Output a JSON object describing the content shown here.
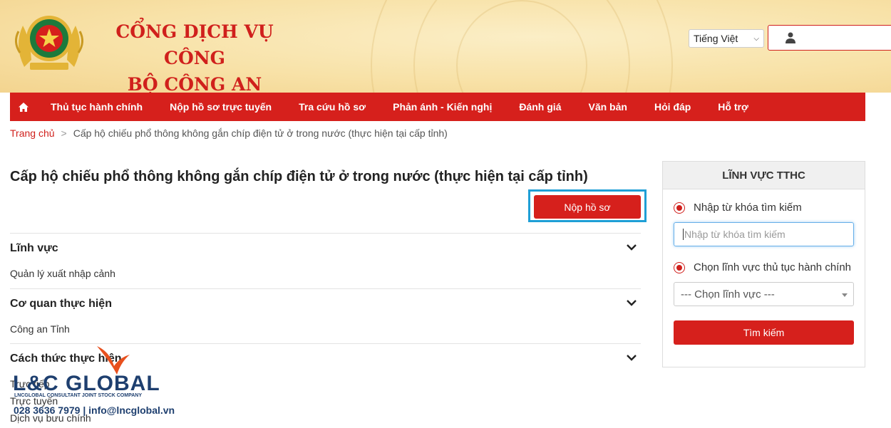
{
  "header": {
    "site_title_line1": "CỔNG DỊCH VỤ CÔNG",
    "site_title_line2": "BỘ CÔNG AN",
    "language": "Tiếng Việt",
    "accent": "#d6201c"
  },
  "nav": {
    "items": [
      {
        "label": "Thủ tục hành chính"
      },
      {
        "label": "Nộp hồ sơ trực tuyến"
      },
      {
        "label": "Tra cứu hồ sơ"
      },
      {
        "label": "Phản ánh - Kiến nghị"
      },
      {
        "label": "Đánh giá"
      },
      {
        "label": "Văn bản"
      },
      {
        "label": "Hỏi đáp"
      },
      {
        "label": "Hỗ trợ"
      }
    ]
  },
  "breadcrumb": {
    "home": "Trang chủ",
    "separator": ">",
    "current": "Cấp hộ chiếu phổ thông không gắn chíp điện tử ở trong nước (thực hiện tại cấp tỉnh)"
  },
  "main": {
    "title": "Cấp hộ chiếu phổ thông không gắn chíp điện tử ở trong nước (thực hiện tại cấp tỉnh)",
    "submit_label": "Nộp hồ sơ",
    "sections": [
      {
        "title": "Lĩnh vực",
        "values": [
          "Quản lý xuất nhập cảnh"
        ]
      },
      {
        "title": "Cơ quan thực hiện",
        "values": [
          "Công an Tỉnh"
        ]
      },
      {
        "title": "Cách thức thực hiện",
        "values": [
          "Trực tiếp",
          "Trực tuyến",
          "Dịch vụ bưu chính"
        ]
      }
    ]
  },
  "sidebar": {
    "header": "LĨNH VỰC TTHC",
    "radio_keyword": "Nhập từ khóa tìm kiếm",
    "keyword_placeholder": "Nhập từ khóa tìm kiếm",
    "radio_field": "Chọn lĩnh vực thủ tục hành chính",
    "field_select": "--- Chọn lĩnh vực ---",
    "search_label": "Tìm kiếm"
  },
  "watermark": {
    "logo": "L&C GLOBAL",
    "subtitle": "LNCGLOBAL CONSULTANT JOINT STOCK COMPANY",
    "contact": "028 3636 7979 | info@lncglobal.vn"
  }
}
